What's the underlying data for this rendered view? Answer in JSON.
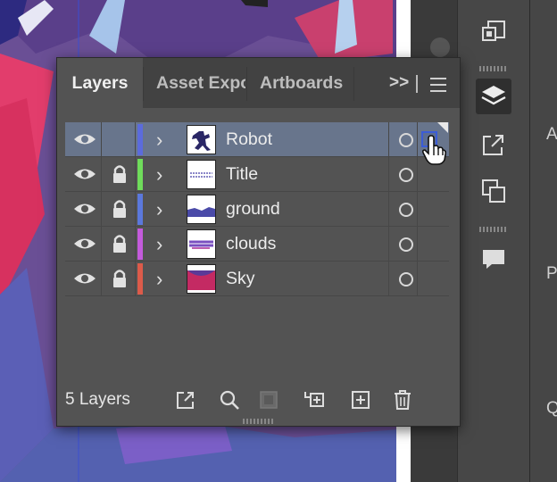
{
  "panel": {
    "tabs": [
      {
        "label": "Layers",
        "active": true
      },
      {
        "label": "Asset Expo",
        "active": false
      },
      {
        "label": "Artboards",
        "active": false
      }
    ],
    "more_label": ">>",
    "layers": [
      {
        "name": "Robot",
        "color": "#5b6bdc",
        "locked": false,
        "selected": true,
        "thumb": "robot"
      },
      {
        "name": "Title",
        "color": "#6fdc5b",
        "locked": true,
        "selected": false,
        "thumb": "title"
      },
      {
        "name": "ground",
        "color": "#5b78dc",
        "locked": true,
        "selected": false,
        "thumb": "ground"
      },
      {
        "name": "clouds",
        "color": "#c45bdc",
        "locked": true,
        "selected": false,
        "thumb": "clouds"
      },
      {
        "name": "Sky",
        "color": "#dc5b4a",
        "locked": true,
        "selected": false,
        "thumb": "sky"
      }
    ],
    "footer": {
      "layer_count": "5 Layers",
      "buttons": [
        "export-icon",
        "locate-object-icon",
        "make-clipping-mask-icon",
        "create-sublayer-icon",
        "create-new-layer-icon",
        "delete-icon"
      ]
    }
  },
  "right_column": {
    "labels": [
      "A",
      "Pa",
      "Q"
    ]
  },
  "colors": {
    "panel_bg": "#535353",
    "selected_row": "#68758c",
    "selection_square": "#3b5cd6"
  }
}
